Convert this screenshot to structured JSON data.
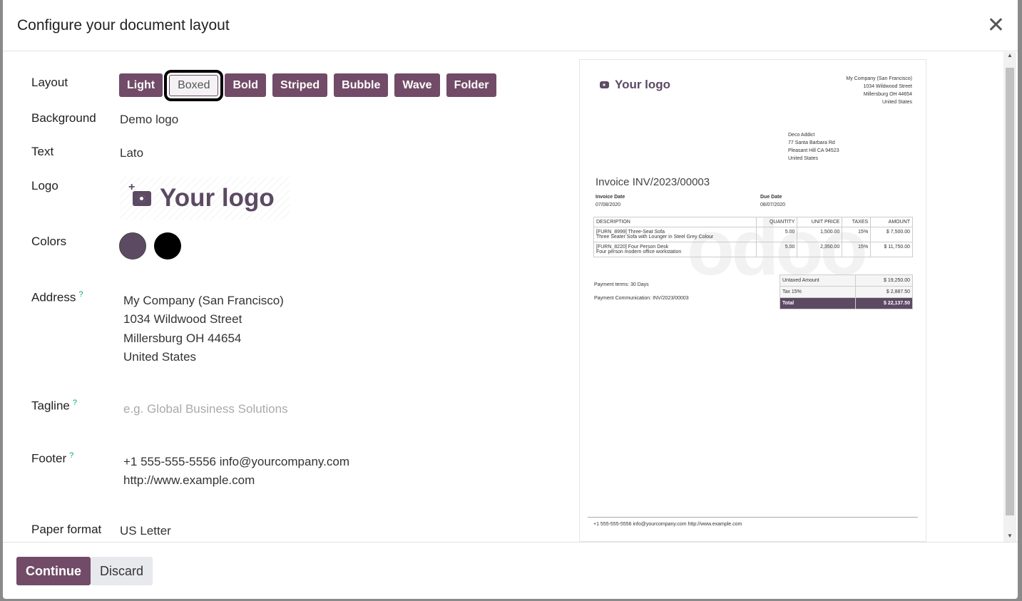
{
  "dialog": {
    "title": "Configure your document layout"
  },
  "form": {
    "layout_label": "Layout",
    "layouts": [
      "Light",
      "Boxed",
      "Bold",
      "Striped",
      "Bubble",
      "Wave",
      "Folder"
    ],
    "selected_layout": "Boxed",
    "background_label": "Background",
    "background_value": "Demo logo",
    "text_label": "Text",
    "text_value": "Lato",
    "logo_label": "Logo",
    "logo_text": "Your logo",
    "colors_label": "Colors",
    "colors": [
      "#5c4a63",
      "#000000"
    ],
    "address_label": "Address",
    "help": "?",
    "address_lines": [
      "My Company (San Francisco)",
      "1034 Wildwood Street",
      "Millersburg OH 44654",
      "United States"
    ],
    "tagline_label": "Tagline",
    "tagline_placeholder": "e.g. Global Business Solutions",
    "footer_label": "Footer",
    "footer_lines": [
      "+1 555-555-5556 info@yourcompany.com",
      "http://www.example.com"
    ],
    "paper_label": "Paper format",
    "paper_value": "US Letter"
  },
  "preview": {
    "logo_text": "Your logo",
    "company": [
      "My Company (San Francisco)",
      "1034 Wildwood Street",
      "Millersburg OH 44654",
      "United States"
    ],
    "customer": [
      "Deco Addict",
      "77 Santa Barbara Rd",
      "Pleasant Hill CA 94523",
      "United States"
    ],
    "title": "Invoice INV/2023/00003",
    "invoice_date_label": "Invoice Date",
    "invoice_date": "07/08/2020",
    "due_date_label": "Due Date",
    "due_date": "08/07/2020",
    "columns": [
      "DESCRIPTION",
      "QUANTITY",
      "UNIT PRICE",
      "TAXES",
      "AMOUNT"
    ],
    "rows": [
      {
        "name": "[FURN_8999] Three-Seat Sofa",
        "desc": "Three Seater Sofa with Lounger in Steel Grey Colour",
        "qty": "5.00",
        "price": "1,500.00",
        "tax": "15%",
        "amount": "$ 7,500.00"
      },
      {
        "name": "[FURN_8220] Four Person Desk",
        "desc": "Four person modern office workstation",
        "qty": "5.00",
        "price": "2,350.00",
        "tax": "15%",
        "amount": "$ 11,750.00"
      }
    ],
    "watermark": "odoo",
    "payment_terms": "Payment terms: 30 Days",
    "payment_comm": "Payment Communication: INV/2023/00003",
    "untaxed_label": "Untaxed Amount",
    "untaxed": "$ 19,250.00",
    "tax_label": "Tax 15%",
    "tax": "$ 2,887.50",
    "total_label": "Total",
    "total": "$ 22,137.50",
    "footer": "+1 555-555-5556 info@yourcompany.com http://www.example.com"
  },
  "actions": {
    "continue": "Continue",
    "discard": "Discard"
  },
  "accent": "#714b67"
}
